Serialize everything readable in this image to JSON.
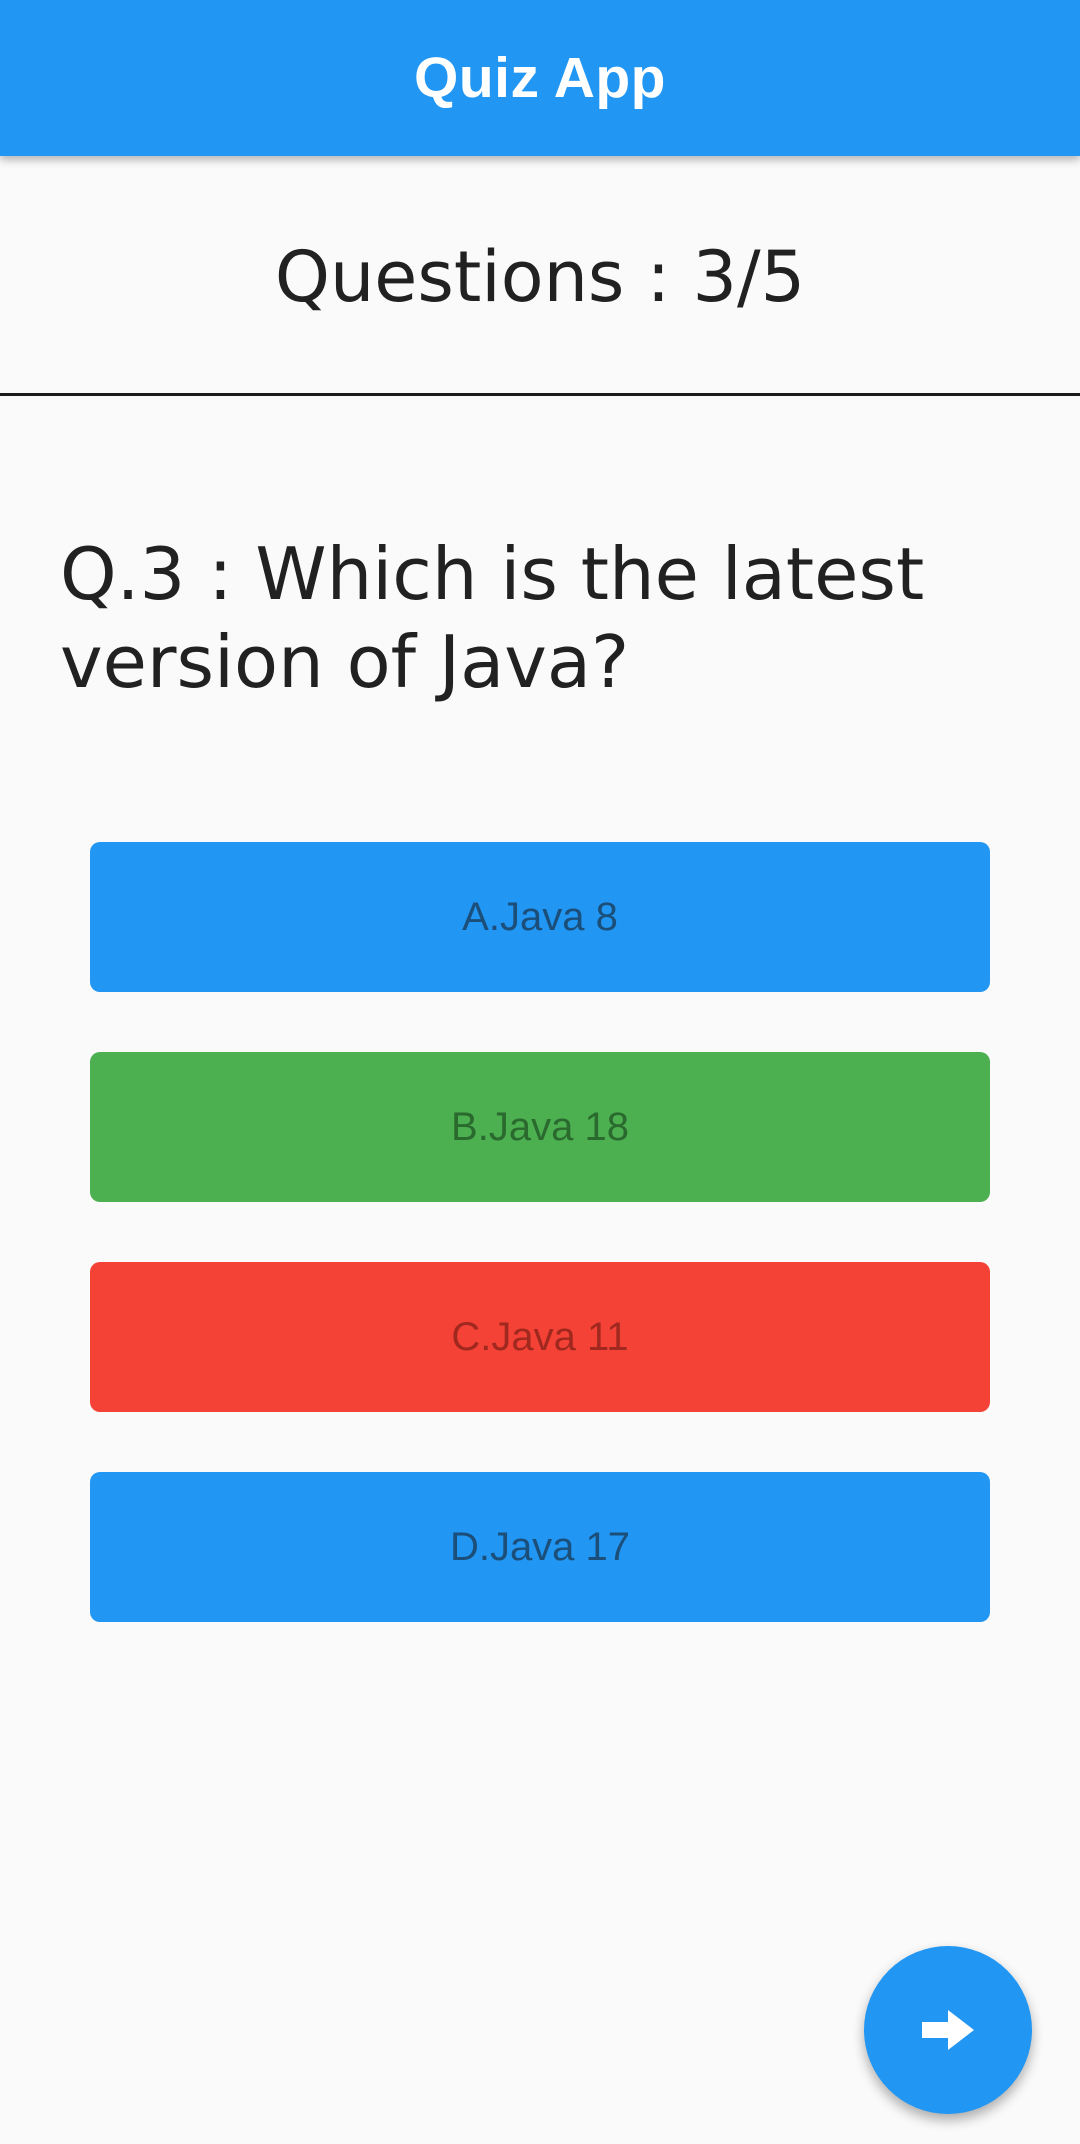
{
  "app_bar": {
    "title": "Quiz App",
    "background": "#2196f3"
  },
  "progress": {
    "label": "Questions : 3/5"
  },
  "question": {
    "text": "Q.3 : Which is the latest version of Java?"
  },
  "options": [
    {
      "label": "A.Java 8",
      "background": "#2196f3",
      "text_color": "#1b4f7a",
      "state": "default"
    },
    {
      "label": "B.Java 18",
      "background": "#4caf50",
      "text_color": "#2a6a2e",
      "state": "correct"
    },
    {
      "label": "C.Java 11",
      "background": "#f44336",
      "text_color": "#a1281f",
      "state": "wrong"
    },
    {
      "label": "D.Java 17",
      "background": "#2196f3",
      "text_color": "#1b4f7a",
      "state": "default"
    }
  ],
  "fab": {
    "icon": "arrow-forward-icon",
    "background": "#2196f3"
  }
}
